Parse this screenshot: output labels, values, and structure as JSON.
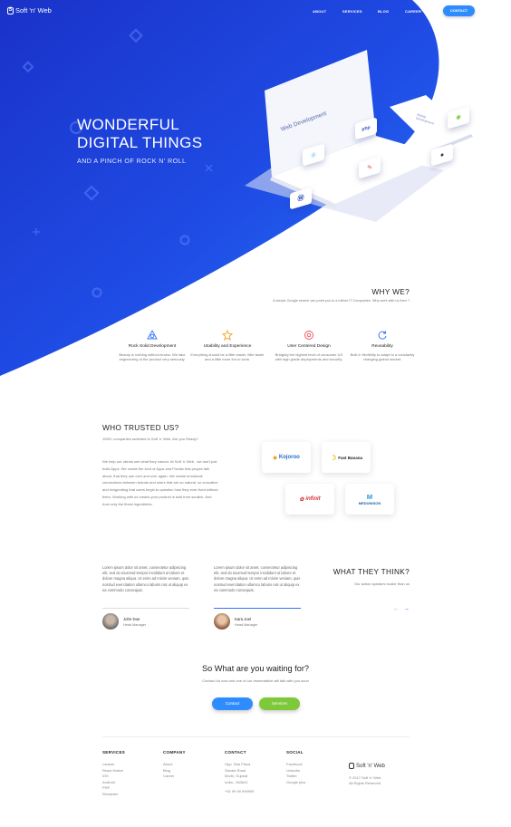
{
  "brand": {
    "name": "Soft 'n' Web"
  },
  "nav": {
    "items": [
      {
        "label": "ABOUT"
      },
      {
        "label": "SERVICES"
      },
      {
        "label": "BLOG"
      },
      {
        "label": "CAREER"
      }
    ],
    "contact_label": "CONTACT"
  },
  "colors": {
    "hero_blue": "#1d3fe0",
    "accent_blue": "#2f8cff",
    "green": "#7dc93a"
  },
  "hero": {
    "title_line1": "WONDERFUL",
    "title_line2": "DIGITAL THINGS",
    "subtitle": "AND A PINCH OF ROCK N' ROLL",
    "screen_text": "Web Development",
    "phone_text": "Mobile Development"
  },
  "why": {
    "title": "WHY WE?",
    "subtitle": "A simple Google search can point you to a million IT Companies. Why work with us then ?",
    "features": [
      {
        "icon": "network-icon",
        "title": "Rock Solid Development",
        "text": "Beauty is nothing without brains. We take engineering of the product very seriously."
      },
      {
        "icon": "star-icon",
        "title": "Usability and Experience",
        "text": "Everything should be a little easier, little faster and a little more fun to work."
      },
      {
        "icon": "target-icon",
        "title": "User Centered Design",
        "text": "Bridging the highest level of consumer UX with high grade deployments and security."
      },
      {
        "icon": "refresh-icon",
        "title": "Reusability",
        "text": "Built in flexibility to adapt to a constantly changing global market."
      }
    ]
  },
  "trust": {
    "title": "WHO TRUSTED US?",
    "subtitle": "1000+ companies switched to Soft 'n' Web. Are you Ready?",
    "body": "We help our clients see what they cannot. At Soft 'n' Web , we don't just build Apps. We create the kind of Apps and Portals that people talk about, that they use over and over again. We create emotional connections between brands and users that are so natural, so evocative and invigorating that users begin to question how they ever lived without them. Working with us means your product is built from scratch. And from only the finest ingredients.",
    "brands": [
      "Kojoroo",
      "Fast Banana",
      "infinit",
      "MEDUNISON"
    ]
  },
  "testimonials": {
    "title": "WHAT THEY THINK?",
    "subtitle": "Our action speakes louder than us",
    "items": [
      {
        "text": "Lorem ipsum dolor sit amet, consectetur adipiscing elit, sed do eiusmod tempor incididunt ut labore et dolore magna aliqua. Ut enim ad minim veniam, quis nostrud exercitation ullamco laboris nisi ut aliquip ex ea commodo consequat.",
        "name": "John Doe",
        "role": "Head Manager"
      },
      {
        "text": "Lorem ipsum dolor sit amet, consectetur adipiscing elit, sed do eiusmod tempor incididunt ut labore et dolore magna aliqua. Ut enim ad minim veniam, quis nostrud exercitation ullamco laboris nisi ut aliquip ex ea commodo consequat.",
        "name": "Kara Joel",
        "role": "Head Manager"
      }
    ]
  },
  "cta": {
    "title": "So What are you waiting for?",
    "subtitle": "Contact Us now and one of our reseentative will talk with you soon",
    "contact_label": "Contact",
    "services_label": "Services"
  },
  "footer": {
    "services": {
      "title": "SERVICES",
      "items": [
        "Laravel",
        "React Native",
        "iOS",
        "Android",
        "PHP",
        "Wordpres"
      ]
    },
    "company": {
      "title": "COMPANY",
      "items": [
        "About",
        "Blog",
        "Career"
      ]
    },
    "contact": {
      "title": "CONTACT",
      "address": [
        "Opp. Star Plaza",
        "Sanala Road",
        "Morbi, Gujarat",
        "India - 363641"
      ],
      "phone": "+91 99 99 999999"
    },
    "social": {
      "title": "SOCIAL",
      "items": [
        "Facebook",
        "LinkedIn",
        "Twitter",
        "Google plus"
      ]
    },
    "copyright_line1": "© 2017 Soft 'n' Web.",
    "copyright_line2": "All Rights Reserved."
  }
}
